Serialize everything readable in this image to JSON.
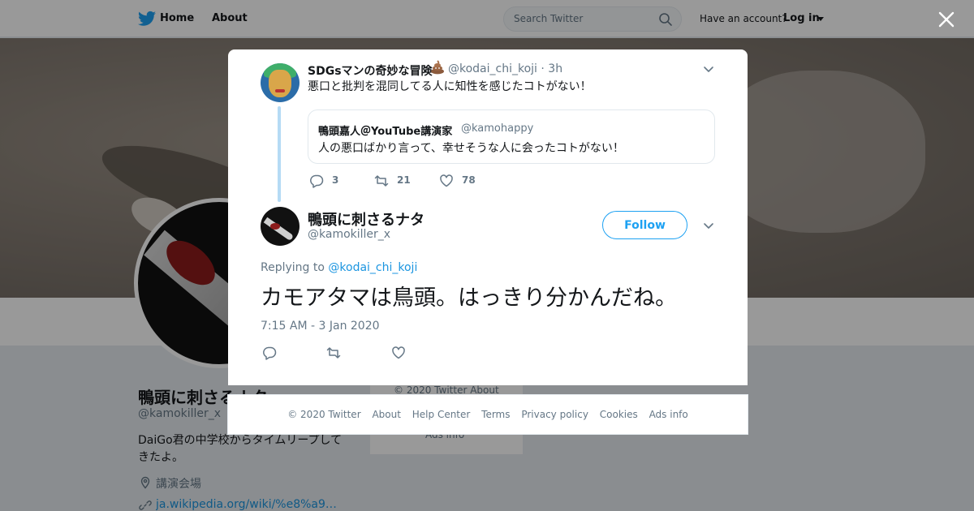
{
  "nav": {
    "home_label": "Home",
    "about_label": "About",
    "search_placeholder": "Search Twitter",
    "have_account": "Have an account?",
    "login_label": "Log in"
  },
  "profile": {
    "name": "鴨頭に刺さるナタ",
    "handle": "@kamokiller_x",
    "bio": "DaiGo君の中学校からタイムリープしてきたよ。",
    "location": "講演会場",
    "link": "ja.wikipedia.org/wiki/%e8%a9%ad…"
  },
  "sidebar_footer": {
    "line1": "© 2020 Twitter   About",
    "line2": "Ads info"
  },
  "parent_tweet": {
    "name": "SDGsマンの奇妙な冒険",
    "handle_time": "@kodai_chi_koji · 3h",
    "text": "悪口と批判を混同してる人に知性を感じたコトがない！",
    "quote": {
      "name": "鴨頭嘉人＠YouTube講演家",
      "handle": "@kamohappy",
      "text": "人の悪口ばかり言って、幸せそうな人に会ったコトがない！"
    },
    "reply_count": "3",
    "retweet_count": "21",
    "like_count": "78"
  },
  "main_tweet": {
    "name": "鴨頭に刺さるナタ",
    "handle": "@kamokiller_x",
    "follow_label": "Follow",
    "replying_prefix": "Replying to ",
    "replying_handle": "@kodai_chi_koji",
    "text": "カモアタマは鳥頭。はっきり分かんだね。",
    "timestamp": "7:15 AM - 3 Jan 2020"
  },
  "footer": {
    "links": [
      "© 2020 Twitter",
      "About",
      "Help Center",
      "Terms",
      "Privacy policy",
      "Cookies",
      "Ads info"
    ]
  },
  "colors": {
    "accent": "#1da1f2",
    "link": "#1b95e0",
    "muted": "#657786",
    "thread_line": "#b5dbf5"
  }
}
